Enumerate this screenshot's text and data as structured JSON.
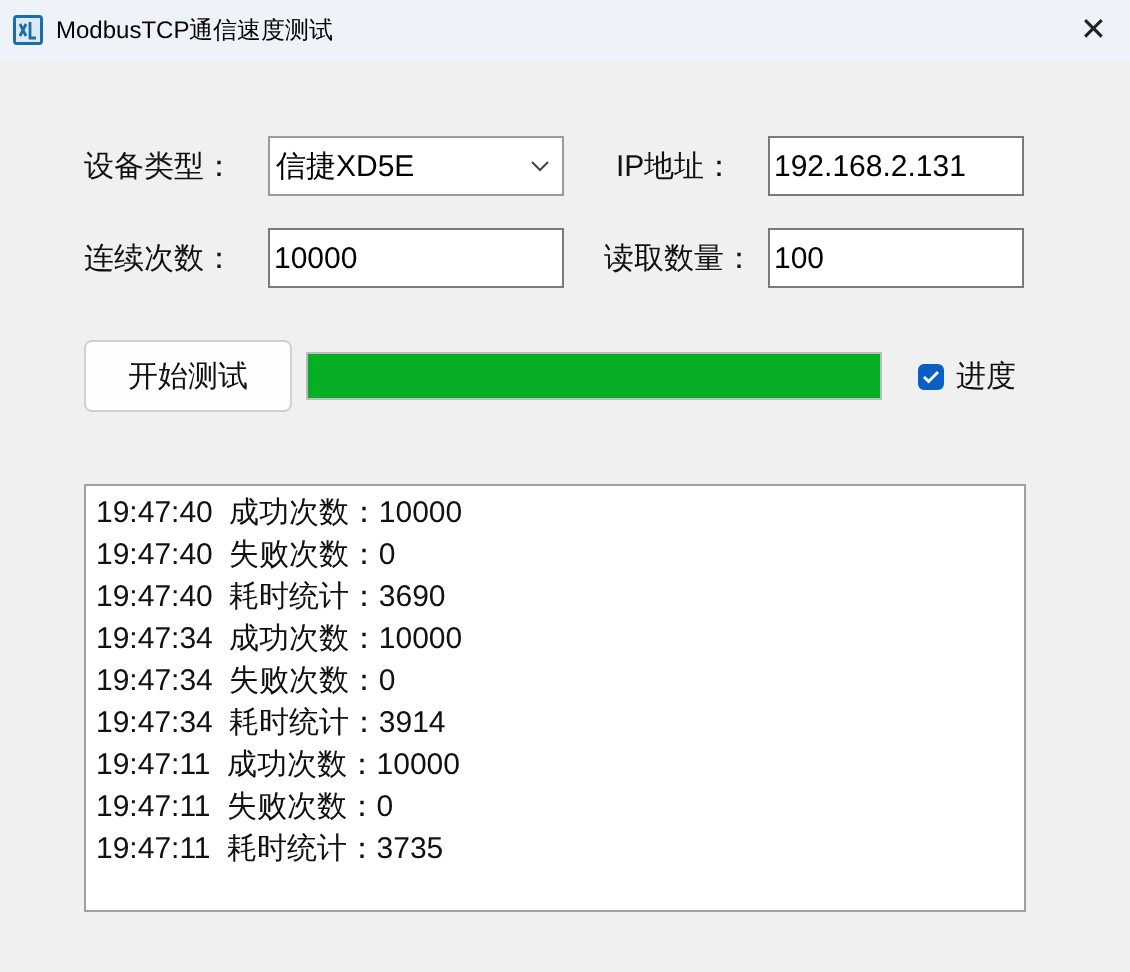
{
  "window": {
    "title": "ModbusTCP通信速度测试",
    "close": "✕"
  },
  "device_type": {
    "label": "设备类型：",
    "value": "信捷XD5E"
  },
  "ip": {
    "label": "IP地址：",
    "value": "192.168.2.131"
  },
  "count": {
    "label": "连续次数：",
    "value": "10000"
  },
  "read_qty": {
    "label": "读取数量：",
    "value": "100"
  },
  "start_button": "开始测试",
  "progress": {
    "level": 1
  },
  "progress_checkbox": {
    "label": "进度",
    "checked": true
  },
  "log": [
    {
      "time": "19:47:40",
      "text": "成功次数：10000"
    },
    {
      "time": "19:47:40",
      "text": "失败次数：0"
    },
    {
      "time": "19:47:40",
      "text": "耗时统计：3690"
    },
    {
      "time": "19:47:34",
      "text": "成功次数：10000"
    },
    {
      "time": "19:47:34",
      "text": "失败次数：0"
    },
    {
      "time": "19:47:34",
      "text": "耗时统计：3914"
    },
    {
      "time": "19:47:11",
      "text": "成功次数：10000"
    },
    {
      "time": "19:47:11",
      "text": "失败次数：0"
    },
    {
      "time": "19:47:11",
      "text": "耗时统计：3735"
    }
  ]
}
